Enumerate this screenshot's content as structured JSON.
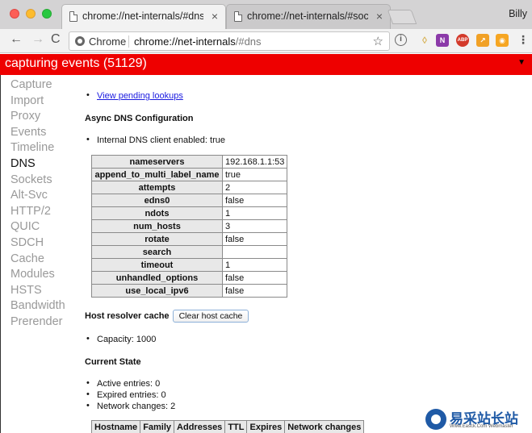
{
  "window": {
    "profile_name": "Billy",
    "tabs": [
      {
        "title": "chrome://net-internals/#dns",
        "active": true
      },
      {
        "title": "chrome://net-internals/#socke",
        "active": false
      }
    ]
  },
  "toolbar": {
    "back": "←",
    "forward": "→",
    "reload": "C",
    "site_label": "Chrome",
    "url_host": "chrome://net-internals",
    "url_path": "/#dns",
    "star": "☆",
    "info_icon": "i",
    "faded_icon": "◊",
    "onenote_icon": "N",
    "abp_icon": "ABP",
    "chart_icon": "↗",
    "note_icon": "◉",
    "menu_icon": "⋮"
  },
  "capture_bar": {
    "status": "capturing events (51129)",
    "arrow": "▼"
  },
  "sidebar": {
    "items": [
      {
        "label": "Capture",
        "active": false
      },
      {
        "label": "Import",
        "active": false
      },
      {
        "label": "Proxy",
        "active": false
      },
      {
        "label": "Events",
        "active": false
      },
      {
        "label": "Timeline",
        "active": false
      },
      {
        "label": "DNS",
        "active": true
      },
      {
        "label": "Sockets",
        "active": false
      },
      {
        "label": "Alt-Svc",
        "active": false
      },
      {
        "label": "HTTP/2",
        "active": false
      },
      {
        "label": "QUIC",
        "active": false
      },
      {
        "label": "SDCH",
        "active": false
      },
      {
        "label": "Cache",
        "active": false
      },
      {
        "label": "Modules",
        "active": false
      },
      {
        "label": "HSTS",
        "active": false
      },
      {
        "label": "Bandwidth",
        "active": false
      },
      {
        "label": "Prerender",
        "active": false
      }
    ]
  },
  "main": {
    "pending_link": "View pending lookups",
    "async_heading": "Async DNS Configuration",
    "internal_client": "Internal DNS client enabled: true",
    "config_rows": [
      {
        "key": "nameservers",
        "value": "192.168.1.1:53"
      },
      {
        "key": "append_to_multi_label_name",
        "value": "true"
      },
      {
        "key": "attempts",
        "value": "2"
      },
      {
        "key": "edns0",
        "value": "false"
      },
      {
        "key": "ndots",
        "value": "1"
      },
      {
        "key": "num_hosts",
        "value": "3"
      },
      {
        "key": "rotate",
        "value": "false"
      },
      {
        "key": "search",
        "value": ""
      },
      {
        "key": "timeout",
        "value": "1"
      },
      {
        "key": "unhandled_options",
        "value": "false"
      },
      {
        "key": "use_local_ipv6",
        "value": "false"
      }
    ],
    "host_cache_label": "Host resolver cache",
    "clear_button": "Clear host cache",
    "capacity": "Capacity: 1000",
    "current_state_heading": "Current State",
    "state_items": [
      "Active entries: 0",
      "Expired entries: 0",
      "Network changes: 2"
    ],
    "host_table_headers": [
      "Hostname",
      "Family",
      "Addresses",
      "TTL",
      "Expires",
      "Network changes"
    ]
  },
  "watermark": {
    "cn": "易采站长站",
    "en": "Www.Easck.Com Webmaster"
  }
}
